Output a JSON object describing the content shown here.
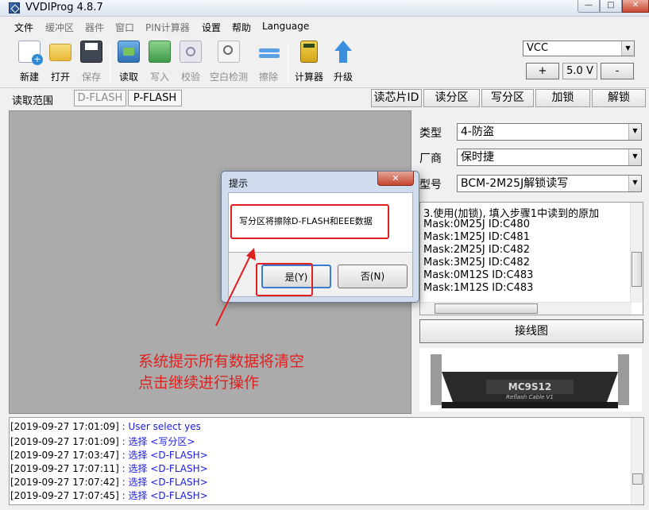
{
  "window": {
    "title": "VVDIProg 4.8.7"
  },
  "menu": [
    "文件",
    "缓冲区",
    "器件",
    "窗口",
    "PIN计算器",
    "设置",
    "帮助",
    "Language"
  ],
  "toolbar": {
    "new": "新建",
    "open": "打开",
    "save": "保存",
    "read": "读取",
    "write": "写入",
    "verify": "校验",
    "blank_check": "空白检测",
    "erase": "擦除",
    "calculator": "计算器",
    "upgrade": "升级"
  },
  "vcc": {
    "selected": "VCC",
    "value": "5.0 V",
    "plus": "+",
    "minus": "-"
  },
  "range": {
    "label": "读取范围",
    "tab_dflash": "D-FLASH",
    "tab_pflash": "P-FLASH",
    "read_id": "读芯片ID",
    "read_partition": "读分区",
    "write_partition": "写分区",
    "lock": "加锁",
    "unlock": "解锁"
  },
  "fields": {
    "type_label": "类型",
    "type_value": "4-防盗",
    "maker_label": "厂商",
    "maker_value": "保时捷",
    "model_label": "型号",
    "model_value": "BCM-2M25J解锁读写"
  },
  "info_lines": [
    "3.使用(加锁), 填入步骤1中读到的原加",
    "Mask:0M25J ID:C480",
    "Mask:1M25J ID:C481",
    "Mask:2M25J ID:C482",
    "Mask:3M25J ID:C482",
    "Mask:0M12S ID:C483",
    "Mask:1M12S ID:C483"
  ],
  "wiring_button": "接线图",
  "cable": {
    "brand": "MC9S12",
    "subtitle": "Reflash Cable V1"
  },
  "log": [
    {
      "ts": "[2019-09-27 17:01:09]",
      "sep": " : ",
      "msg": "User select yes"
    },
    {
      "ts": "[2019-09-27 17:01:09]",
      "sep": " : ",
      "msg": "选择 <写分区>"
    },
    {
      "ts": "[2019-09-27 17:03:47]",
      "sep": " : ",
      "msg": "选择 <D-FLASH>"
    },
    {
      "ts": "[2019-09-27 17:07:11]",
      "sep": " : ",
      "msg": "选择 <D-FLASH>"
    },
    {
      "ts": "[2019-09-27 17:07:42]",
      "sep": " : ",
      "msg": "选择 <D-FLASH>"
    },
    {
      "ts": "[2019-09-27 17:07:45]",
      "sep": " : ",
      "msg": "选择 <D-FLASH>"
    }
  ],
  "dialog": {
    "title": "提示",
    "message": "写分区将擦除D-FLASH和EEE数据",
    "yes": "是(Y)",
    "no": "否(N)"
  },
  "annotation": {
    "line1": "系统提示所有数据将清空",
    "line2": "点击继续进行操作"
  },
  "colors": {
    "annotation_red": "#e0201f",
    "log_blue": "#1a1ae6",
    "workspace_gray": "#ababab"
  }
}
